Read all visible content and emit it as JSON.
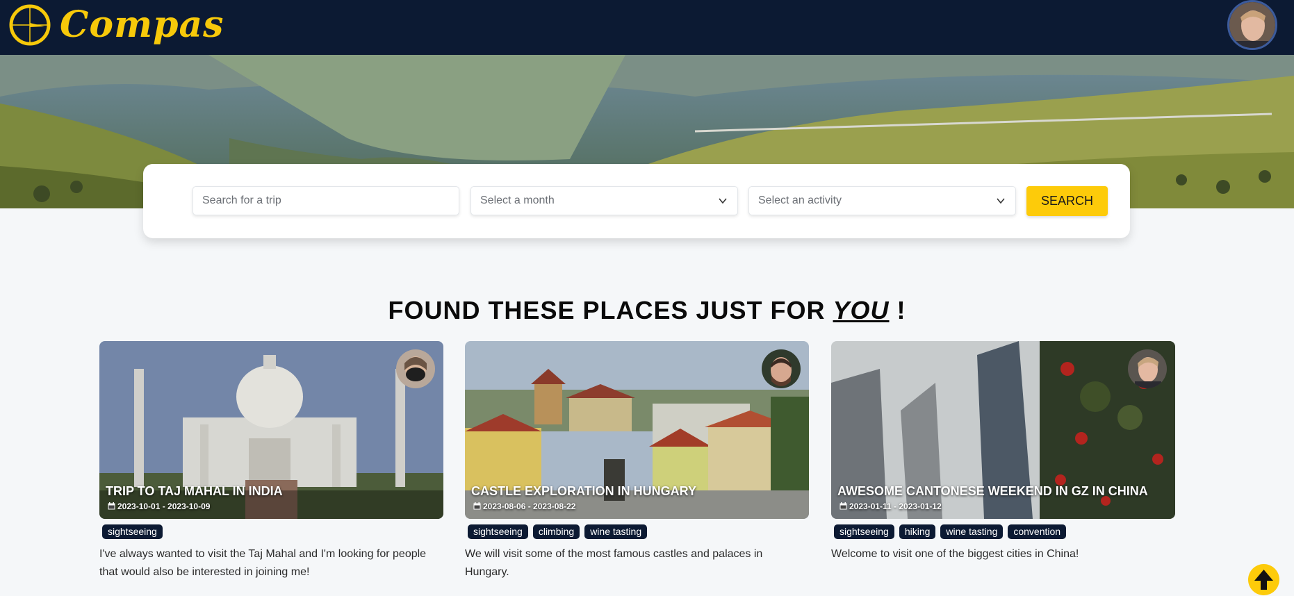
{
  "header": {
    "logo_text": "Compas",
    "logo_icon": "compass-logo-icon",
    "avatar_icon": "user-avatar"
  },
  "search": {
    "trip_placeholder": "Search for a trip",
    "month_placeholder": "Select a month",
    "activity_placeholder": "Select an activity",
    "button_label": "SEARCH"
  },
  "section": {
    "heading_prefix": "FOUND THESE PLACES JUST FOR ",
    "heading_emphasis": "YOU",
    "heading_suffix": " !"
  },
  "cards": [
    {
      "title": "TRIP TO TAJ MAHAL IN INDIA",
      "dates": "2023-10-01 - 2023-10-09",
      "tags": [
        "sightseeing"
      ],
      "description": "I've always wanted to visit the Taj Mahal and I'm looking for people that would also be interested in joining me!"
    },
    {
      "title": "CASTLE EXPLORATION IN HUNGARY",
      "dates": "2023-08-06 - 2023-08-22",
      "tags": [
        "sightseeing",
        "climbing",
        "wine tasting"
      ],
      "description": "We will visit some of the most famous castles and palaces in Hungary."
    },
    {
      "title": "AWESOME CANTONESE WEEKEND IN GZ IN CHINA",
      "dates": "2023-01-11 - 2023-01-12",
      "tags": [
        "sightseeing",
        "hiking",
        "wine tasting",
        "convention"
      ],
      "description": "Welcome to visit one of the biggest cities in China!"
    }
  ],
  "colors": {
    "header_bg": "#0c1a33",
    "accent": "#fdcb0a",
    "tag_bg": "#0c1a33"
  },
  "icons": {
    "chevron": "chevron-down-icon",
    "calendar": "calendar-icon",
    "scroll_top": "arrow-up-icon"
  }
}
